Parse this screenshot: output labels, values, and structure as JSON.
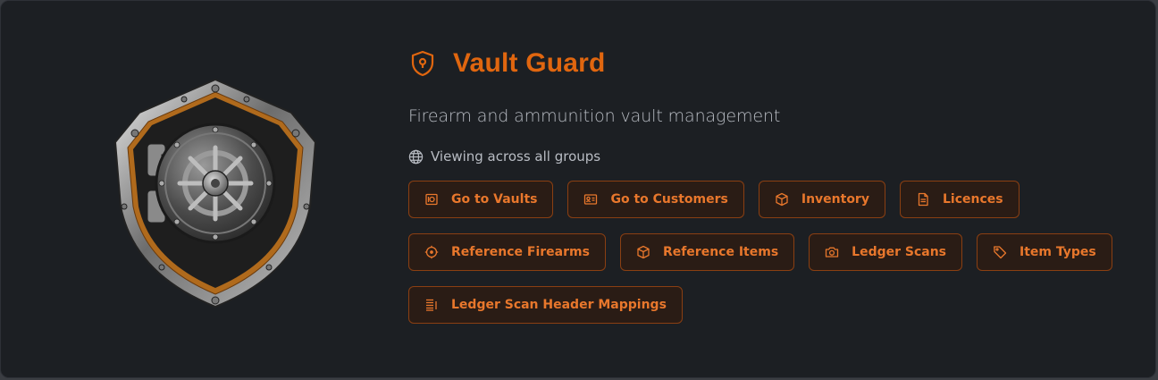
{
  "app": {
    "title": "Vault Guard",
    "subtitle": "Firearm and ammunition vault management",
    "scope_text": "Viewing across all groups",
    "logo_icon": "shield-vault-logo",
    "accent_color": "#e0660f"
  },
  "buttons": {
    "row1": [
      {
        "label": "Go to Vaults",
        "icon": "vault-icon"
      },
      {
        "label": "Go to Customers",
        "icon": "id-card-icon"
      },
      {
        "label": "Inventory",
        "icon": "box-icon"
      },
      {
        "label": "Licences",
        "icon": "document-icon"
      }
    ],
    "row2": [
      {
        "label": "Reference Firearms",
        "icon": "crosshair-icon"
      },
      {
        "label": "Reference Items",
        "icon": "box-icon"
      },
      {
        "label": "Ledger Scans",
        "icon": "camera-icon"
      },
      {
        "label": "Item Types",
        "icon": "tag-icon"
      }
    ],
    "row3": [
      {
        "label": "Ledger Scan Header Mappings",
        "icon": "list-icon"
      }
    ]
  }
}
